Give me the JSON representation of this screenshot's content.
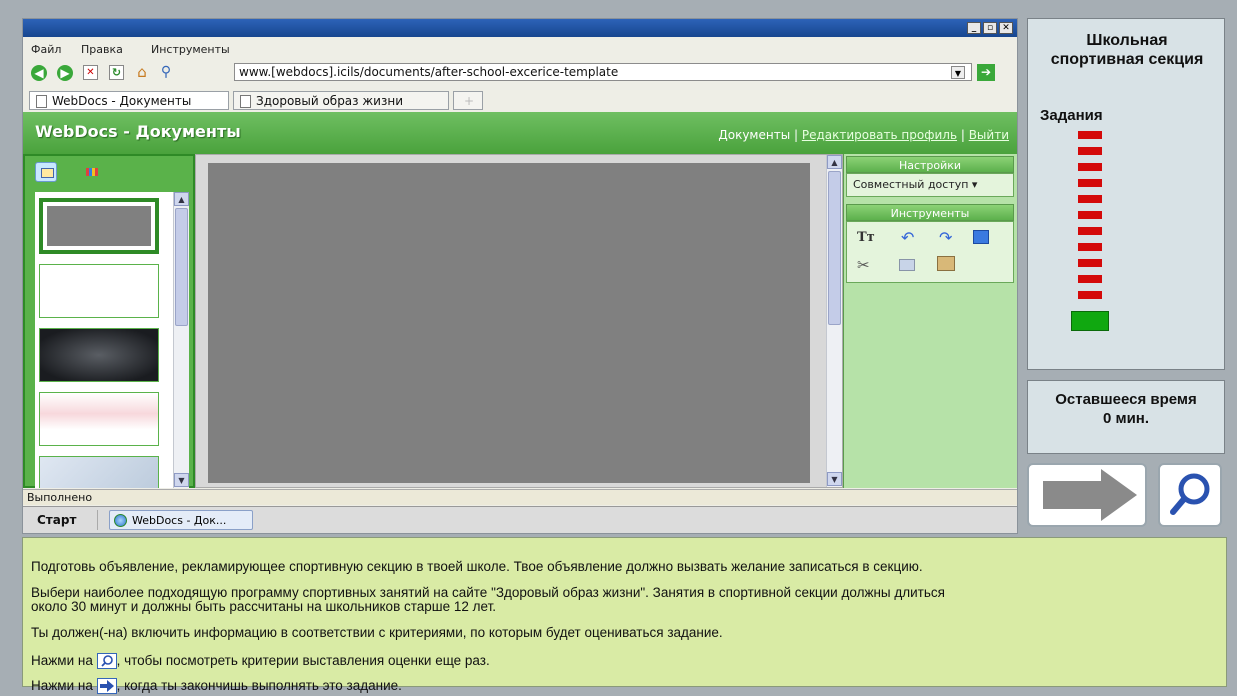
{
  "window": {
    "menu": [
      "Файл",
      "Правка",
      "Инструменты"
    ],
    "url": "www.[webdocs].icils/documents/after-school-excerice-template",
    "tabs": [
      "WebDocs - Документы",
      "Здоровый образ жизни",
      "+"
    ]
  },
  "webdocs": {
    "title": "WebDocs - Документы",
    "links": {
      "documents": "Документы",
      "edit_profile": "Редактировать профиль",
      "logout": "Выйти"
    },
    "settings_header": "Настройки",
    "share_label": "Совместный доступ ▾",
    "tools_header": "Инструменты",
    "tools_text_icon": "Tт"
  },
  "status": {
    "text": "Выполнено"
  },
  "taskbar": {
    "start": "Старт",
    "item": "WebDocs - Док..."
  },
  "side": {
    "title": "Школьная спортивная секция",
    "tasks_label": "Задания",
    "remaining_label": "Оставшееся время",
    "remaining_value": "0 мин.",
    "task_count_remaining": 11,
    "task_count_current": 1,
    "colors": {
      "remaining": "#d40a0a",
      "current": "#10a810"
    }
  },
  "instructions": {
    "p1": "Подготовь объявление, рекламирующее  спортивную секцию в твоей школе. Твое объявление должно вызвать желание записаться  в секцию.",
    "p2a": "Выбери наиболее подходящую программу спортивных занятий на сайте \"Здоровый образ жизни\". Занятия в спортивной секции должны длиться",
    "p2b": "около 30 минут и должны быть рассчитаны на  школьников старше 12 лет.",
    "p3": "Ты должен(-на) включить информацию в соответствии с критериями, по которым будет оцениваться задание.",
    "p4_pre": "Нажми на",
    "p4_post": ", чтобы посмотреть критерии выставления оценки еще раз.",
    "p5_pre": "Нажми на",
    "p5_post": ", когда ты закончишь выполнять это задание."
  }
}
